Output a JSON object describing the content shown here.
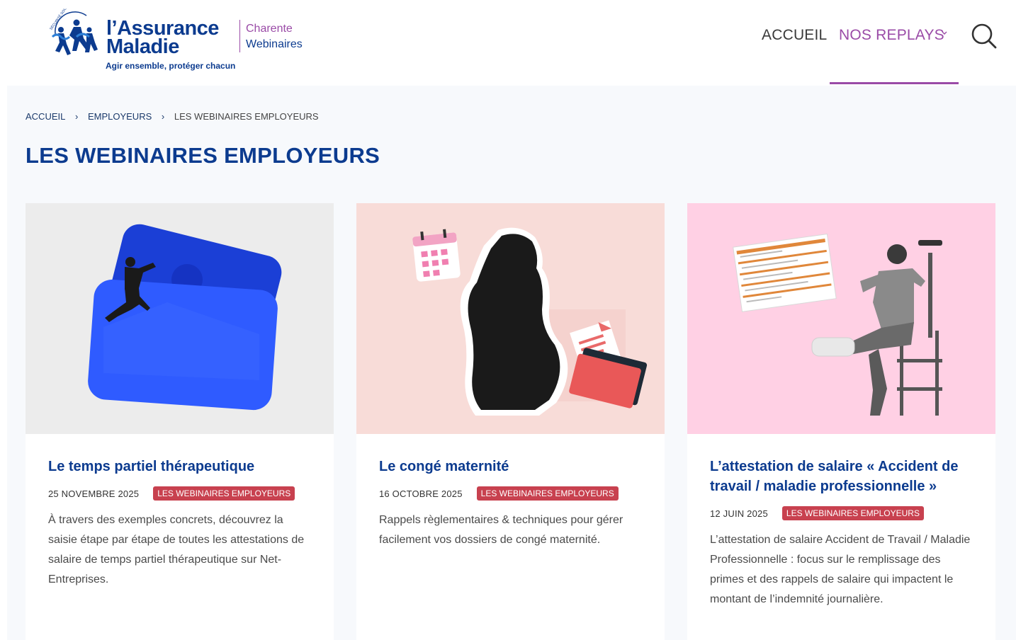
{
  "header": {
    "logo": {
      "arc_text": "SÉCURITÉ SOCIALE",
      "title_line1": "l’Assurance",
      "title_line2": "Maladie",
      "tagline": "Agir ensemble, protéger chacun",
      "region": "Charente",
      "subtitle": "Webinaires"
    },
    "nav": {
      "home": "ACCUEIL",
      "replays": "NOS REPLAYS"
    }
  },
  "breadcrumb": {
    "items": [
      "ACCUEIL",
      "EMPLOYEURS",
      "LES WEBINAIRES EMPLOYEURS"
    ]
  },
  "page": {
    "title": "LES WEBINAIRES EMPLOYEURS"
  },
  "cards": [
    {
      "title": "Le temps partiel thérapeutique",
      "date": "25 NOVEMBRE 2025",
      "tag": "LES WEBINAIRES EMPLOYEURS",
      "description": "À travers des exemples concrets, découvrez la saisie étape par étape de toutes les attestations de salaire de temps partiel thérapeutique sur Net-Entreprises."
    },
    {
      "title": "Le congé maternité",
      "date": "16 OCTOBRE 2025",
      "tag": "LES WEBINAIRES EMPLOYEURS",
      "description": "Rappels règlementaires & techniques pour gérer facilement vos dossiers de congé maternité."
    },
    {
      "title": "L’attestation de salaire « Accident de travail / maladie professionnelle »",
      "date": "12 JUIN 2025",
      "tag": "LES WEBINAIRES EMPLOYEURS",
      "description": "L’attestation de salaire Accident de Travail / Maladie Professionnelle : focus sur le remplissage des primes et des rappels de salaire qui impactent le montant de l’indemnité journalière."
    }
  ],
  "colors": {
    "brand_blue": "#0c3b8f",
    "accent_purple": "#9a4ba7",
    "tag_red": "#c8414f",
    "page_bg": "#f7f9fc"
  }
}
